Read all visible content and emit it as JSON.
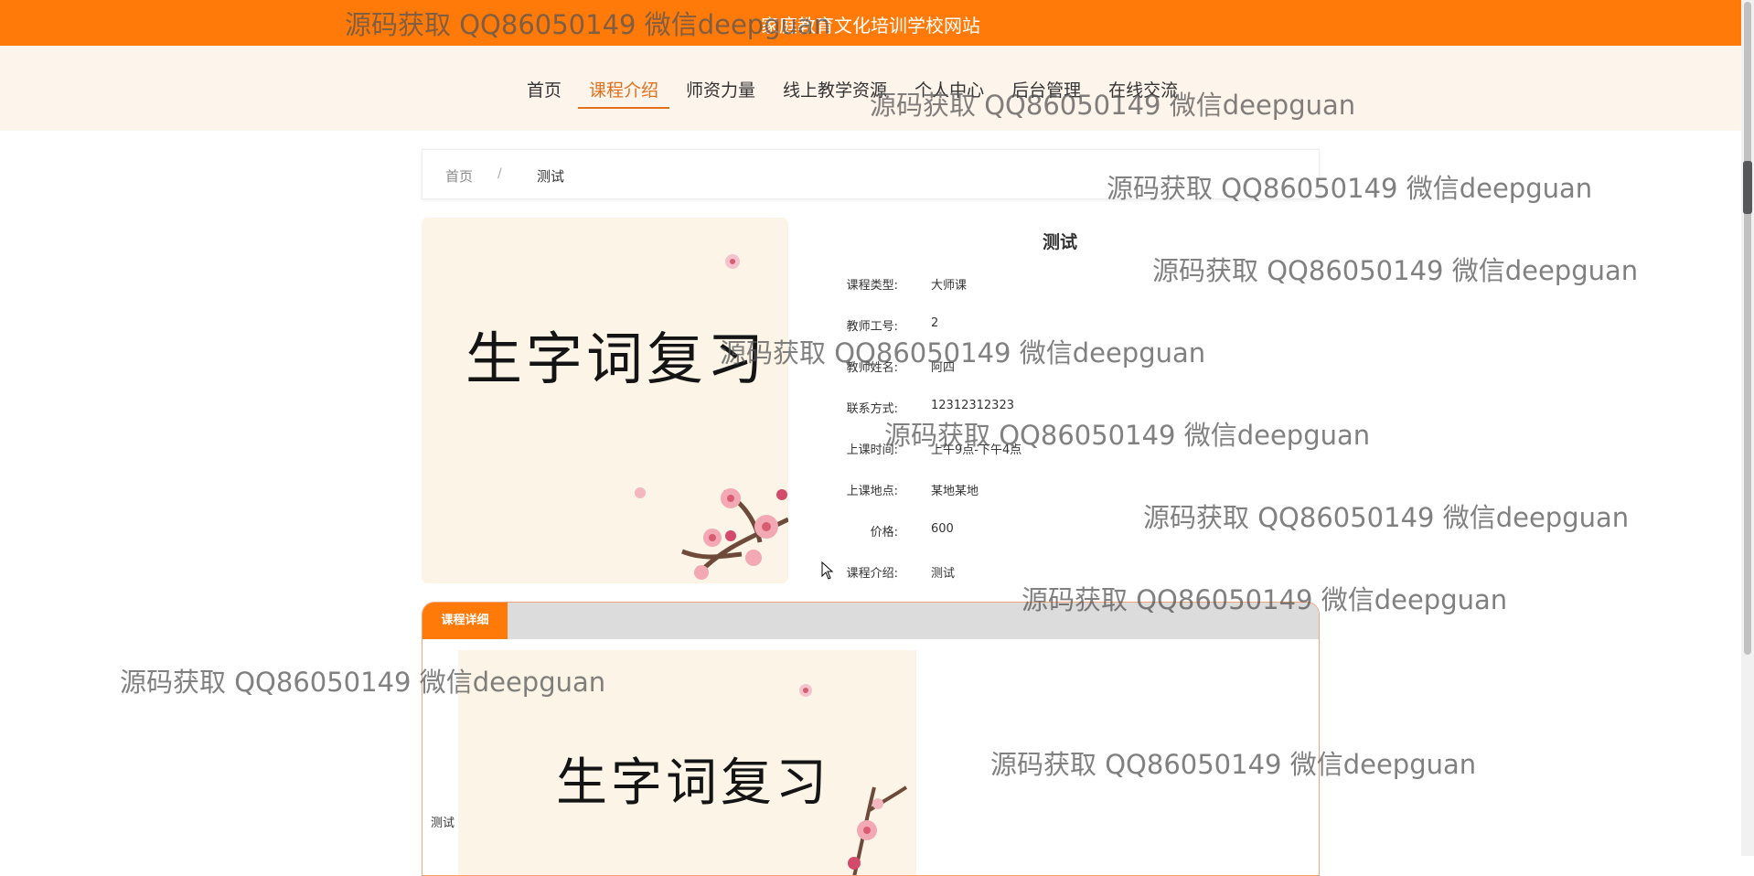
{
  "header": {
    "site_title": "家庭教育文化培训学校网站"
  },
  "nav": {
    "items": [
      {
        "label": "首页",
        "active": false
      },
      {
        "label": "课程介绍",
        "active": true
      },
      {
        "label": "师资力量",
        "active": false
      },
      {
        "label": "线上教学资源",
        "active": false
      },
      {
        "label": "个人中心",
        "active": false
      },
      {
        "label": "后台管理",
        "active": false
      },
      {
        "label": "在线交流",
        "active": false
      }
    ]
  },
  "breadcrumb": {
    "home": "首页",
    "separator": "/",
    "current": "测试"
  },
  "course": {
    "cover_text": "生字词复习",
    "title": "测试",
    "fields": [
      {
        "label": "课程类型:",
        "value": "大师课"
      },
      {
        "label": "教师工号:",
        "value": "2"
      },
      {
        "label": "教师姓名:",
        "value": "阿四"
      },
      {
        "label": "联系方式:",
        "value": "12312312323"
      },
      {
        "label": "上课时间:",
        "value": "上午9点-下午4点"
      },
      {
        "label": "上课地点:",
        "value": "某地某地"
      },
      {
        "label": "价格:",
        "value": "600"
      },
      {
        "label": "课程介绍:",
        "value": "测试"
      }
    ]
  },
  "detail": {
    "tab_label": "课程详细",
    "image_text": "生字词复习",
    "content_text": "测试"
  },
  "watermark": {
    "text": "源码获取 QQ86050149 微信deepguan"
  },
  "colors": {
    "accent": "#ff7a08",
    "nav_active": "#e1701d",
    "nav_bg": "#fdf4ec"
  }
}
